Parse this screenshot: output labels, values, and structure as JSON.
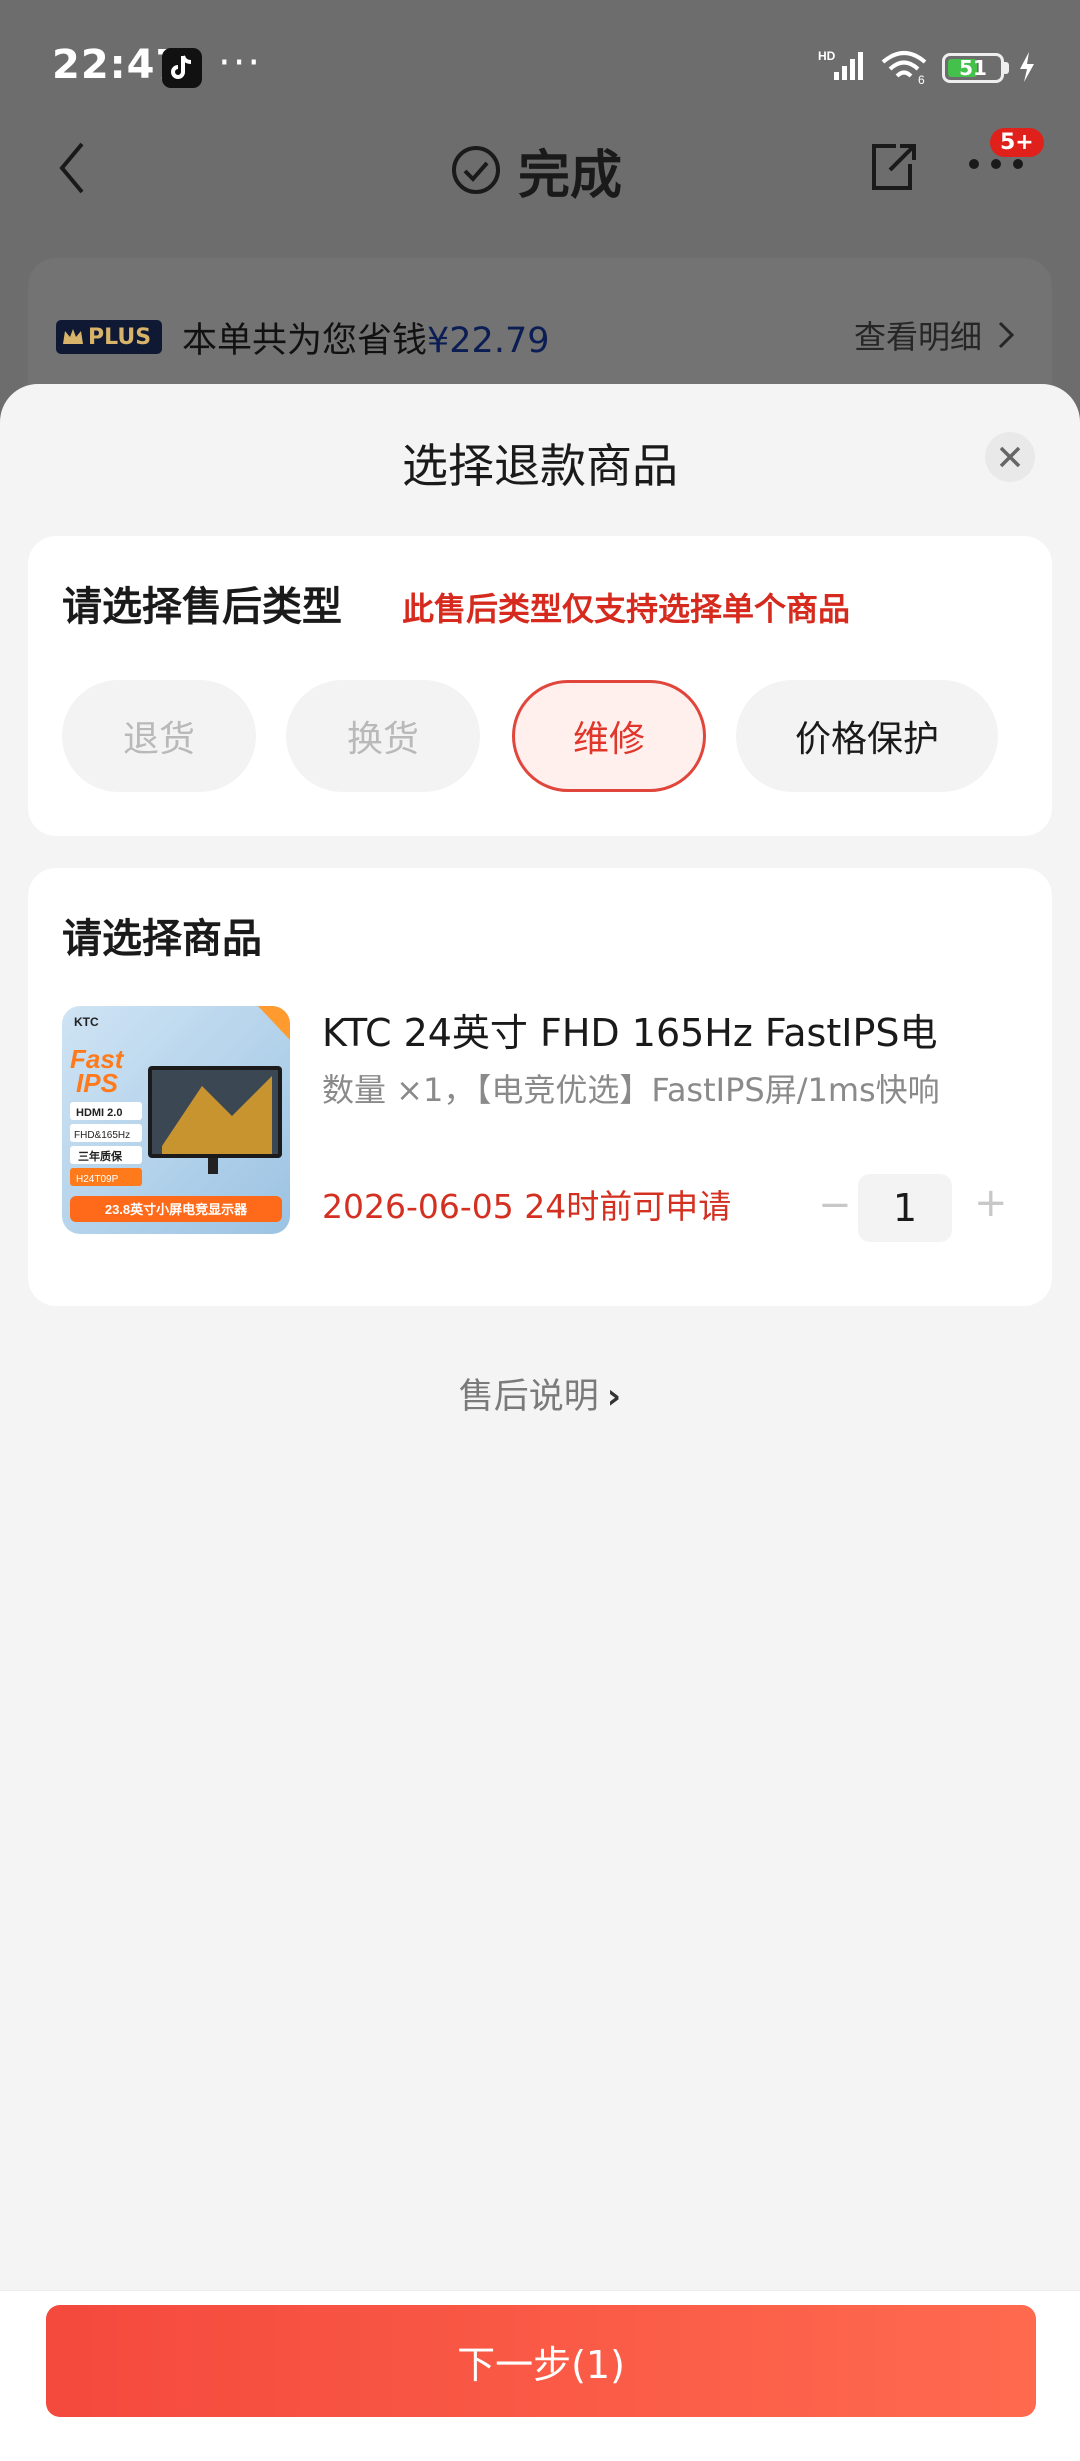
{
  "status_bar": {
    "time": "22:47",
    "battery": "51"
  },
  "nav": {
    "title": "完成",
    "badge": "5+"
  },
  "plus_bar": {
    "badge": "PLUS",
    "text": "本单共为您省钱",
    "amount": "¥22.79",
    "link": "查看明细"
  },
  "sheet": {
    "title": "选择退款商品",
    "type_section": {
      "title": "请选择售后类型",
      "warning": "此售后类型仅支持选择单个商品",
      "options": [
        {
          "label": "退货",
          "state": "disabled"
        },
        {
          "label": "换货",
          "state": "disabled"
        },
        {
          "label": "维修",
          "state": "selected"
        },
        {
          "label": "价格保护",
          "state": "normal"
        }
      ]
    },
    "product_section": {
      "title": "请选择商品",
      "product": {
        "name": "KTC 24英寸 FHD 165Hz FastIPS电",
        "spec": "数量 ×1，【电竞优选】FastIPS屏/1ms快响",
        "deadline": "2026-06-05 24时前可申请",
        "quantity": "1",
        "thumb": {
          "brand": "KTC",
          "headline1": "Fast",
          "headline2": "IPS",
          "tags": [
            "HDMI 2.0",
            "FHD&165Hz",
            "三年质保",
            "H24T09P"
          ],
          "banner": "23.8英寸小屏电竞显示器"
        }
      }
    },
    "after_sales_link": "售后说明",
    "next_button": "下一步(1)"
  },
  "colors": {
    "accent": "#e0362b",
    "button": "#f4493d",
    "warning": "#d62a1e"
  }
}
